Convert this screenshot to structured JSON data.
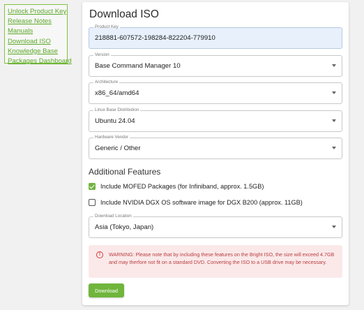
{
  "sidebar": {
    "links": [
      "Unlock Product Key",
      "Release Notes",
      "Manuals",
      "Download ISO",
      "Knowledge Base",
      "Packages Dashboard"
    ]
  },
  "form": {
    "title": "Download ISO",
    "product_key": {
      "label": "Product Key",
      "value": "218881-607572-198284-822204-779910"
    },
    "version": {
      "label": "Version",
      "value": "Base Command Manager 10"
    },
    "architecture": {
      "label": "Architecture",
      "value": "x86_64/amd64"
    },
    "distribution": {
      "label": "Linux Base Distribution",
      "value": "Ubuntu 24.04"
    },
    "vendor": {
      "label": "Hardware Vendor",
      "value": "Generic / Other"
    },
    "additional_features": "Additional Features",
    "mofed": {
      "label": "Include MOFED Packages (for Infiniband, approx. 1.5GB)",
      "checked": true
    },
    "dgx": {
      "label": "Include NVIDIA DGX OS software image for DGX B200 (approx. 11GB)",
      "checked": false
    },
    "location": {
      "label": "Download Location",
      "value": "Asia (Tokyo, Japan)"
    },
    "warning": "WARNING: Please note that by including these features on the Bright ISO, the size will exceed 4.7GB and may therfore not fit on a standard DVD. Converting the ISO to a USB drive may be necessary.",
    "download_label": "Download"
  },
  "colors": {
    "accent": "#72b340",
    "link": "#5ea829",
    "warning_bg": "#fbe9ea",
    "warning_text": "#b83d3d"
  }
}
